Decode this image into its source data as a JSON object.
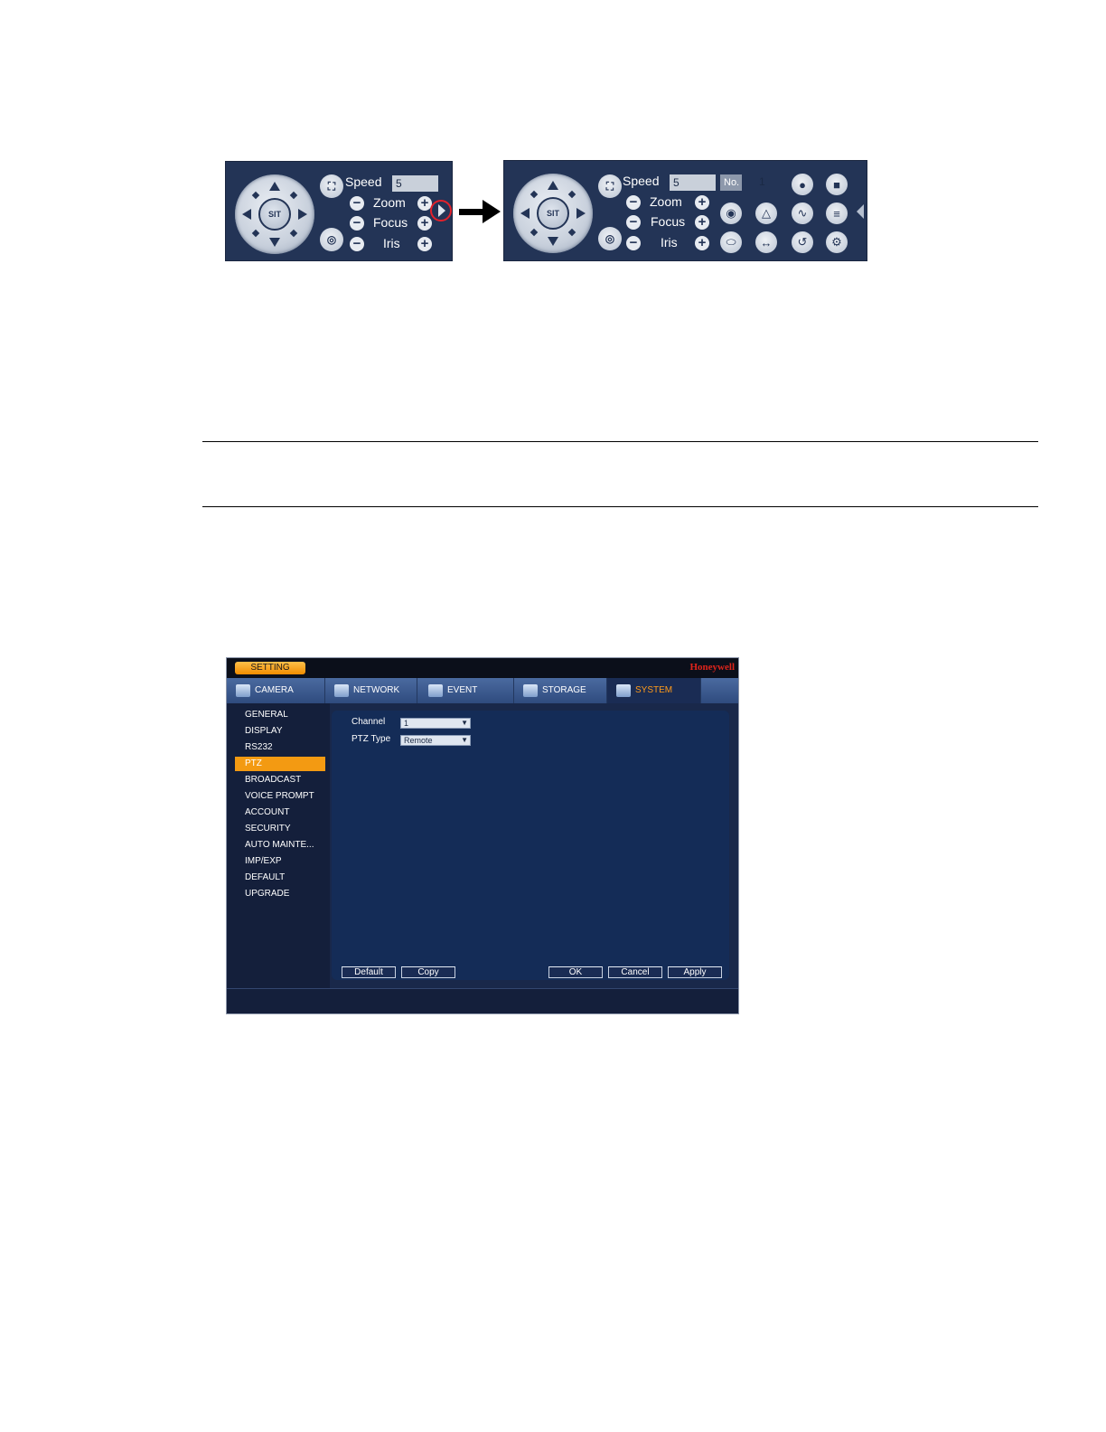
{
  "ptz_panel_small": {
    "center_label": "SIT",
    "speed_label": "Speed",
    "speed_value": "5",
    "zoom_label": "Zoom",
    "focus_label": "Focus",
    "iris_label": "Iris",
    "expand_icon": "chevron-right-icon"
  },
  "arrow_icon": "arrow-right-icon",
  "ptz_panel_large": {
    "center_label": "SIT",
    "speed_label": "Speed",
    "speed_value": "5",
    "no_label": "No.",
    "no_value": "1",
    "zoom_label": "Zoom",
    "focus_label": "Focus",
    "iris_label": "Iris",
    "collapse_icon": "chevron-left-icon"
  },
  "setting_window": {
    "title_tab": "SETTING",
    "brand": "Honeywell",
    "tabs": [
      {
        "label": "CAMERA",
        "icon": "camera-icon"
      },
      {
        "label": "NETWORK",
        "icon": "network-icon"
      },
      {
        "label": "EVENT",
        "icon": "event-icon"
      },
      {
        "label": "STORAGE",
        "icon": "storage-icon"
      },
      {
        "label": "SYSTEM",
        "icon": "system-icon"
      }
    ],
    "active_tab": "SYSTEM",
    "sidebar": [
      "GENERAL",
      "DISPLAY",
      "RS232",
      "PTZ",
      "BROADCAST",
      "VOICE PROMPT",
      "ACCOUNT",
      "SECURITY",
      "AUTO MAINTE...",
      "IMP/EXP",
      "DEFAULT",
      "UPGRADE"
    ],
    "active_sidebar": "PTZ",
    "channel_label": "Channel",
    "channel_value": "1",
    "ptz_type_label": "PTZ Type",
    "ptz_type_value": "Remote",
    "buttons": {
      "default": "Default",
      "copy": "Copy",
      "ok": "OK",
      "cancel": "Cancel",
      "apply": "Apply"
    },
    "colors": {
      "active_tab_text": "#ff9a1a",
      "active_sidebar_bg": "#f39a12",
      "brand_red": "#e0241b"
    }
  }
}
